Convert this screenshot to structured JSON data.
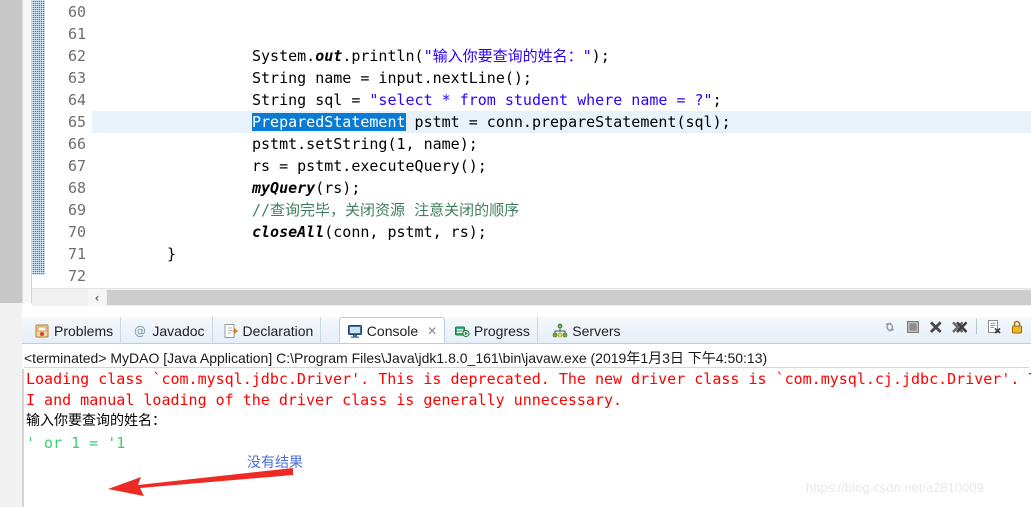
{
  "editor": {
    "first_line": 60,
    "highlighted_line": 65,
    "selection_text": "PreparedStatement",
    "lines": [
      {
        "num": "60",
        "segments": []
      },
      {
        "num": "61",
        "segments": []
      },
      {
        "num": "62",
        "segments": [
          {
            "t": "System.",
            "c": "plain"
          },
          {
            "t": "out",
            "c": "static"
          },
          {
            "t": ".println(",
            "c": "plain"
          },
          {
            "t": "\"输入你要查询的姓名：\"",
            "c": "str"
          },
          {
            "t": ");",
            "c": "plain"
          }
        ]
      },
      {
        "num": "63",
        "segments": [
          {
            "t": "String name = input.nextLine();",
            "c": "plain"
          }
        ]
      },
      {
        "num": "64",
        "segments": [
          {
            "t": "String sql = ",
            "c": "plain"
          },
          {
            "t": "\"select * from student where name = ?\"",
            "c": "str"
          },
          {
            "t": ";",
            "c": "plain"
          }
        ]
      },
      {
        "num": "65",
        "segments": [
          {
            "t": "PreparedStatement",
            "c": "sel"
          },
          {
            "t": " pstmt = conn.prepareStatement(sql);",
            "c": "plain"
          }
        ]
      },
      {
        "num": "66",
        "segments": [
          {
            "t": "pstmt.setString(1, name);",
            "c": "plain"
          }
        ]
      },
      {
        "num": "67",
        "segments": [
          {
            "t": "rs = pstmt.executeQuery();",
            "c": "plain"
          }
        ]
      },
      {
        "num": "68",
        "segments": [
          {
            "t": "myQuery",
            "c": "method"
          },
          {
            "t": "(rs);",
            "c": "plain"
          }
        ]
      },
      {
        "num": "69",
        "segments": [
          {
            "t": "//查询完毕，关闭资源 注意关闭的顺序",
            "c": "cmt"
          }
        ]
      },
      {
        "num": "70",
        "segments": [
          {
            "t": "closeAll",
            "c": "method"
          },
          {
            "t": "(conn, pstmt, rs);",
            "c": "plain"
          }
        ]
      },
      {
        "num": "71",
        "segments": [
          {
            "t": "}",
            "c": "brace",
            "indent": 0
          }
        ]
      },
      {
        "num": "72",
        "segments": []
      }
    ],
    "scroll_left_arrow": "‹"
  },
  "panel": {
    "tabs": [
      {
        "label": "Problems",
        "icon": "problems-icon",
        "active": false,
        "closable": false
      },
      {
        "label": "Javadoc",
        "icon": "javadoc-icon",
        "active": false,
        "closable": false
      },
      {
        "label": "Declaration",
        "icon": "declaration-icon",
        "active": false,
        "closable": false
      },
      {
        "label": "Console",
        "icon": "console-icon",
        "active": true,
        "closable": true,
        "close_glyph": "✕"
      },
      {
        "label": "Progress",
        "icon": "progress-icon",
        "active": false,
        "closable": false
      },
      {
        "label": "Servers",
        "icon": "servers-icon",
        "active": false,
        "closable": false
      }
    ],
    "toolbar_icons": [
      "terminate-all-icon",
      "stop-icon",
      "remove-launch-icon",
      "remove-all-terminated-icon",
      "separator",
      "clear-console-icon",
      "scroll-lock-icon"
    ],
    "status_line": "<terminated> MyDAO [Java Application] C:\\Program Files\\Java\\jdk1.8.0_161\\bin\\javaw.exe (2019年1月3日 下午4:50:13)",
    "console_output": [
      {
        "text": "Loading class `com.mysql.jdbc.Driver'. This is deprecated. The new driver class is `com.mysql.cj.jdbc.Driver'. The driver is automatically registered via the SP",
        "stream": "err"
      },
      {
        "text": "I and manual loading of the driver class is generally unnecessary.",
        "stream": "err"
      },
      {
        "text": "输入你要查询的姓名：",
        "stream": "out"
      },
      {
        "text": "' or 1 = '1",
        "stream": "in"
      }
    ]
  },
  "annotation": {
    "text": "没有结果",
    "arrow_color": "#ee2a24",
    "text_color": "#4a6fd4"
  },
  "watermark": "https://blog.csdn.net/a2810009",
  "colors": {
    "selection_blue": "#0a7bd4",
    "line_highlight": "#e8f2fb",
    "string_blue": "#2a00ff",
    "comment_green": "#3f7f5f",
    "error_red": "#ff0000",
    "input_green": "#3bd16f",
    "change_bar_blue": "#1a8fd4"
  }
}
